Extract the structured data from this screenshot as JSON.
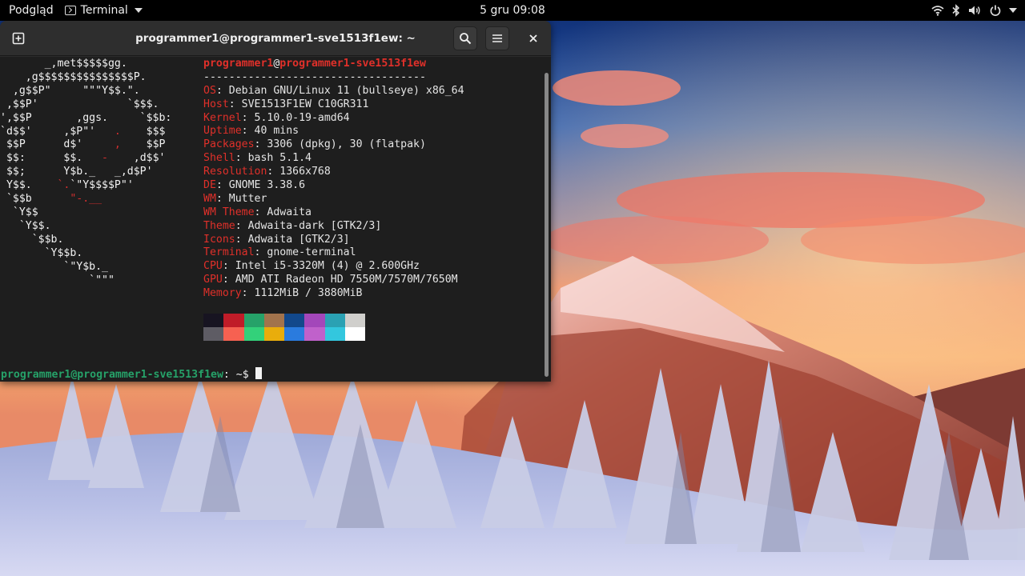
{
  "topbar": {
    "activities": "Podgląd",
    "app_name": "Terminal",
    "clock": "5 gru  09:08",
    "icons": [
      "wifi-icon",
      "bluetooth-icon",
      "volume-icon",
      "power-icon",
      "chevron-down-icon"
    ]
  },
  "window": {
    "title": "programmer1@programmer1-sve1513f1ew: ~",
    "buttons": [
      "new-tab-icon",
      "search-icon",
      "hamburger-menu-icon",
      "close-icon"
    ]
  },
  "neofetch": {
    "user": "programmer1",
    "at": "@",
    "host": "programmer1-sve1513f1ew",
    "separator": "-----------------------------------",
    "info": [
      {
        "key": "OS",
        "value": ": Debian GNU/Linux 11 (bullseye) x86_64"
      },
      {
        "key": "Host",
        "value": ": SVE1513F1EW C10GR311"
      },
      {
        "key": "Kernel",
        "value": ": 5.10.0-19-amd64"
      },
      {
        "key": "Uptime",
        "value": ": 40 mins"
      },
      {
        "key": "Packages",
        "value": ": 3306 (dpkg), 30 (flatpak)"
      },
      {
        "key": "Shell",
        "value": ": bash 5.1.4"
      },
      {
        "key": "Resolution",
        "value": ": 1366x768"
      },
      {
        "key": "DE",
        "value": ": GNOME 3.38.6"
      },
      {
        "key": "WM",
        "value": ": Mutter"
      },
      {
        "key": "WM Theme",
        "value": ": Adwaita"
      },
      {
        "key": "Theme",
        "value": ": Adwaita-dark [GTK2/3]"
      },
      {
        "key": "Icons",
        "value": ": Adwaita [GTK2/3]"
      },
      {
        "key": "Terminal",
        "value": ": gnome-terminal"
      },
      {
        "key": "CPU",
        "value": ": Intel i5-3320M (4) @ 2.600GHz"
      },
      {
        "key": "GPU",
        "value": ": AMD ATI Radeon HD 7550M/7570M/7650M"
      },
      {
        "key": "Memory",
        "value": ": 1112MiB / 3880MiB"
      }
    ],
    "palette_top": [
      "#171421",
      "#c01c28",
      "#26a269",
      "#a2734c",
      "#12488b",
      "#a347ba",
      "#2aa1b3",
      "#d0cfcc"
    ],
    "palette_bottom": [
      "#5e5c64",
      "#f66151",
      "#33d17a",
      "#e9ad0c",
      "#2a7bde",
      "#c061cb",
      "#33c7de",
      "#ffffff"
    ]
  },
  "prompt": {
    "userhost": "programmer1@programmer1-sve1513f1ew",
    "suffix": ": ~$ "
  },
  "colors": {
    "prompt_green": "#26a269",
    "info_key_red": "#e0302a"
  }
}
